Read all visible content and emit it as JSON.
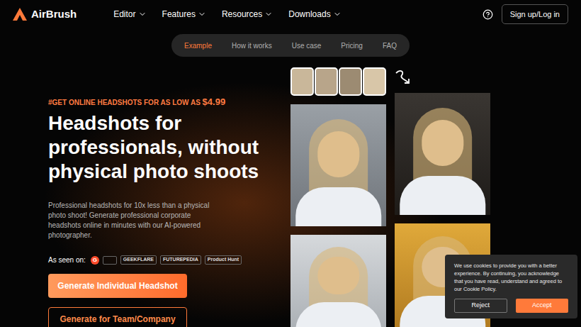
{
  "header": {
    "logo": "AirBrush",
    "nav": [
      {
        "label": "Editor",
        "has_menu": true
      },
      {
        "label": "Features",
        "has_menu": true
      },
      {
        "label": "Resources",
        "has_menu": true
      },
      {
        "label": "Downloads",
        "has_menu": true
      }
    ],
    "signup": "Sign up/Log in"
  },
  "subnav": [
    {
      "label": "Example",
      "selected": true
    },
    {
      "label": "How it works",
      "selected": false
    },
    {
      "label": "Use case",
      "selected": false
    },
    {
      "label": "Pricing",
      "selected": false
    },
    {
      "label": "FAQ",
      "selected": false
    }
  ],
  "hero": {
    "tagline": "#GET ONLINE HEADSHOTS FOR AS LOW AS ",
    "price": "$4.99",
    "title": "Headshots for professionals, without physical photo shoots",
    "description": "Professional headshots for 10x less than a physical photo shoot! Generate professional corporate headshots online in minutes with our AI-powered photographer.",
    "as_seen_on": "As seen on:",
    "logos": [
      "G",
      "",
      "GEEKFLARE",
      "FUTUREPEDIA",
      "Product Hunt"
    ],
    "primary_button": "Generate Individual Headshot",
    "secondary_button": "Generate for Team/Company"
  },
  "cookie": {
    "text": "We use cookies to provide you with a better experience. By continuing, you acknowledge that you have read, understand and agreed to our Cookie Policy.",
    "reject": "Reject",
    "accept": "Accept"
  }
}
